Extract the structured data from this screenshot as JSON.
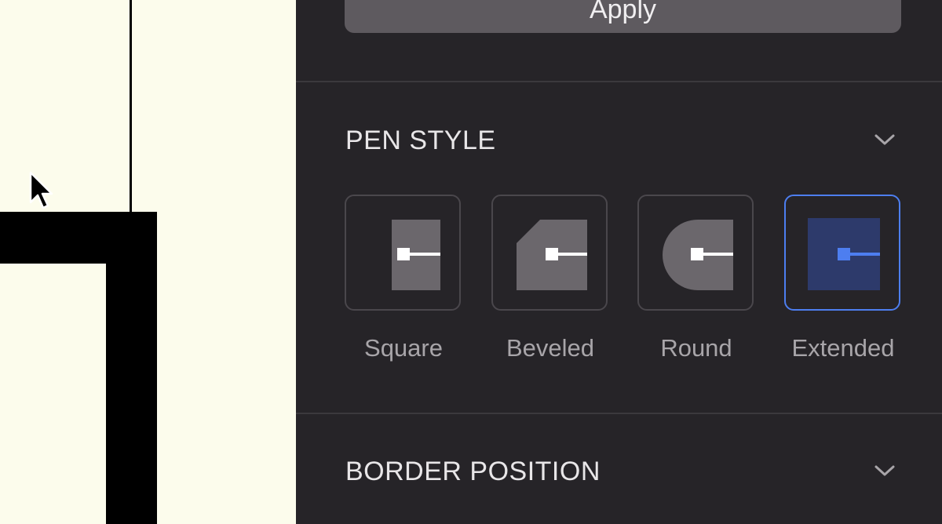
{
  "panel": {
    "apply_label": "Apply",
    "pen_style": {
      "title": "PEN STYLE",
      "options": [
        {
          "label": "Square",
          "icon": "square-cap-icon",
          "selected": false
        },
        {
          "label": "Beveled",
          "icon": "beveled-cap-icon",
          "selected": false
        },
        {
          "label": "Round",
          "icon": "round-cap-icon",
          "selected": false
        },
        {
          "label": "Extended",
          "icon": "extended-cap-icon",
          "selected": true
        }
      ]
    },
    "border_position": {
      "title": "BORDER POSITION"
    }
  },
  "colors": {
    "canvas_bg": "#fcfcec",
    "panel_bg": "#262428",
    "accent": "#4d7ef0"
  }
}
